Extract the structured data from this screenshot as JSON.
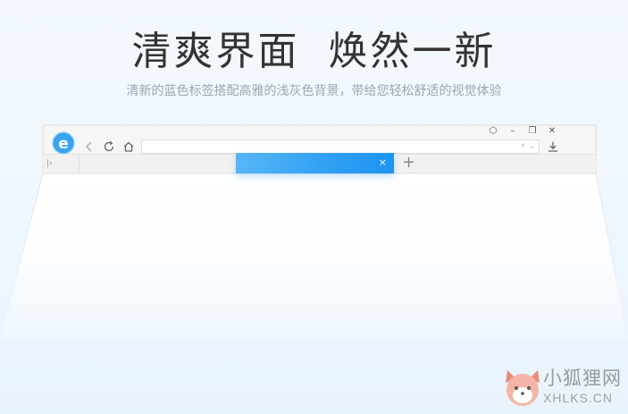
{
  "hero": {
    "title_part1": "清爽界面",
    "title_part2": "焕然一新",
    "subtitle": "清新的蓝色标签搭配高雅的浅灰色背景，带给您轻松舒适的视觉体验"
  },
  "browser": {
    "logo_icon": "ie-e-logo-icon",
    "window_controls": [
      {
        "name": "skin-icon",
        "label": "⬡"
      },
      {
        "name": "minimize-button",
        "label": "–"
      },
      {
        "name": "restore-button",
        "label": "❐"
      },
      {
        "name": "close-button",
        "label": "✕"
      }
    ],
    "nav_icons": [
      "back-icon",
      "refresh-icon",
      "home-icon"
    ],
    "address_bar": {
      "value": "",
      "indicators": "⚡ ⌄"
    },
    "sidebar_toggle": "|›",
    "active_tab": {
      "title": "",
      "close_label": "×"
    },
    "new_tab_label": "+",
    "accent_color": "#1e94f0"
  },
  "watermark": {
    "name_cn": "小狐狸网",
    "domain": "XHLKS.CN"
  }
}
